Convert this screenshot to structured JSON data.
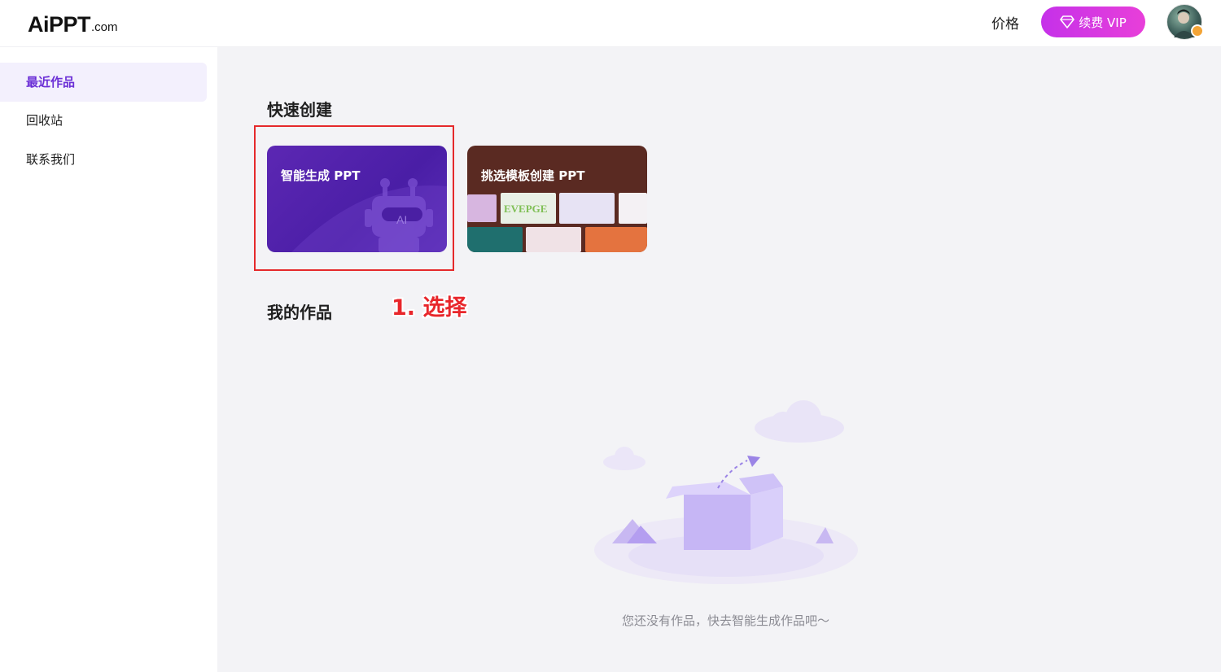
{
  "header": {
    "logo_main": "AiPPT",
    "logo_sub": ".com",
    "price_label": "价格",
    "vip_label": "续费 VIP"
  },
  "sidebar": {
    "items": [
      {
        "label": "最近作品",
        "active": true
      },
      {
        "label": "回收站",
        "active": false
      },
      {
        "label": "联系我们",
        "active": false
      }
    ]
  },
  "main": {
    "quick_create_title": "快速创建",
    "cards": [
      {
        "label": "智能生成 PPT",
        "icon": "robot-icon",
        "badge": "AI"
      },
      {
        "label": "挑选模板创建 PPT"
      }
    ],
    "annotation": "1. 选择",
    "my_works_title": "我的作品",
    "empty_text": "您还没有作品，快去智能生成作品吧～"
  },
  "colors": {
    "accent": "#6b2fd6",
    "vip_gradient_start": "#c531e9",
    "vip_gradient_end": "#e83fd9",
    "highlight": "#e5292b"
  }
}
